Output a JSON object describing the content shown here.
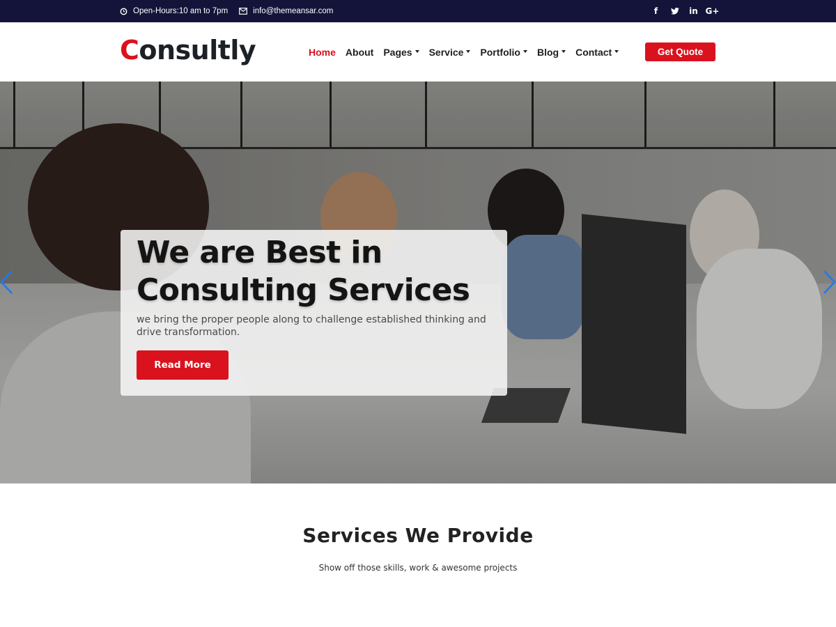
{
  "topbar": {
    "hours_icon": "clock-icon",
    "hours": "Open-Hours:10 am to 7pm",
    "email_icon": "envelope-icon",
    "email": "info@themeansar.com",
    "social": [
      {
        "name": "facebook-icon",
        "glyph": "f"
      },
      {
        "name": "twitter-icon",
        "glyph": "🐦"
      },
      {
        "name": "linkedin-icon",
        "glyph": "in"
      },
      {
        "name": "google-plus-icon",
        "glyph": "G+"
      }
    ]
  },
  "header": {
    "logo_first": "C",
    "logo_rest": "onsultly",
    "nav": [
      {
        "label": "Home",
        "active": true,
        "dropdown": false
      },
      {
        "label": "About",
        "active": false,
        "dropdown": false
      },
      {
        "label": "Pages",
        "active": false,
        "dropdown": true
      },
      {
        "label": "Service",
        "active": false,
        "dropdown": true
      },
      {
        "label": "Portfolio",
        "active": false,
        "dropdown": true
      },
      {
        "label": "Blog",
        "active": false,
        "dropdown": true
      },
      {
        "label": "Contact",
        "active": false,
        "dropdown": true
      }
    ],
    "cta": "Get Quote"
  },
  "hero": {
    "title_line1": "We are Best in",
    "title_line2": "Consulting Services",
    "subtitle": "we bring the proper people along to challenge established thinking and drive transformation.",
    "button": "Read More",
    "prev_icon": "chevron-left-icon",
    "next_icon": "chevron-right-icon"
  },
  "services": {
    "title": "Services We Provide",
    "subtitle": "Show off those skills, work & awesome projects"
  },
  "colors": {
    "accent": "#d9121e",
    "topbar_bg": "#14143a",
    "arrow": "#1e7bf0",
    "text_dark": "#1c2127"
  }
}
